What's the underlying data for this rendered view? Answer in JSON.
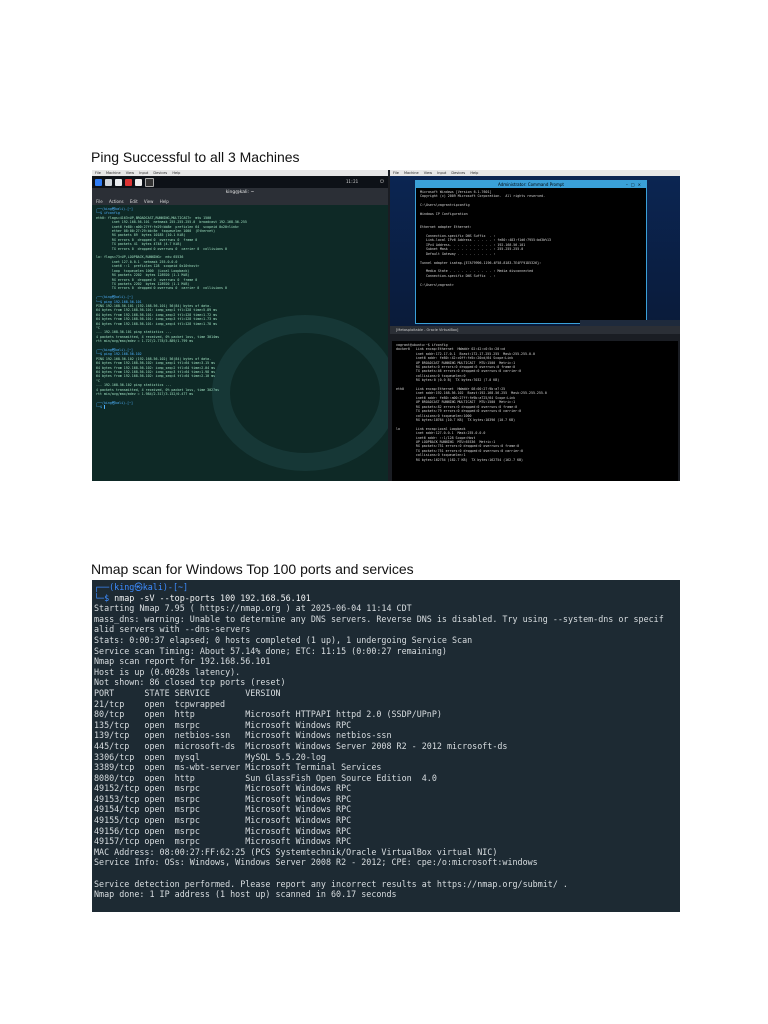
{
  "headings": {
    "ping": "Ping Successful to all 3 Machines",
    "nmap": "Nmap scan for Windows Top 100 ports and services"
  },
  "screenshot1": {
    "vm_menu": [
      "File",
      "Machine",
      "View",
      "Input",
      "Devices",
      "Help"
    ],
    "kali": {
      "window_title": "king@kali: ~",
      "term_menu": [
        "File",
        "Actions",
        "Edit",
        "View",
        "Help"
      ],
      "clock": "11:21",
      "lines": [
        "┌──(king㉿kali)-[~]",
        "└─$ ifconfig",
        "eth0: flags=4163<UP,BROADCAST,RUNNING,MULTICAST>  mtu 1500",
        "        inet 192.168.56.101  netmask 255.255.255.0  broadcast 192.168.56.255",
        "        inet6 fe80::a00:27ff:fe29:bb8e  prefixlen 64  scopeid 0x20<link>",
        "        ether 08:00:27:29:bb:8e  txqueuelen 1000  (Ethernet)",
        "        RX packets 89  bytes 10185 (10.1 KiB)",
        "        RX errors 0  dropped 0  overruns 0  frame 0",
        "        TX packets 41  bytes 4748 (4.7 KiB)",
        "        TX errors 0  dropped 0 overruns 0  carrier 0  collisions 0",
        "",
        "lo: flags=73<UP,LOOPBACK,RUNNING>  mtu 65536",
        "        inet 127.0.0.1  netmask 255.0.0.0",
        "        inet6 ::1  prefixlen 128  scopeid 0x10<host>",
        "        loop  txqueuelen 1000  (Local Loopback)",
        "        RX packets 2202  bytes 128920 (1.1 MiB)",
        "        RX errors 0  dropped 0  overruns 0  frame 0",
        "        TX packets 2202  bytes 128920 (1.1 MiB)",
        "        TX errors 0  dropped 0 overruns 0  carrier 0  collisions 0",
        "",
        "┌──(king㉿kali)-[~]",
        "└─$ ping 192.168.56.101",
        "PING 192.168.56.101 (192.168.56.101) 56(84) bytes of data.",
        "64 bytes from 192.168.56.101: icmp_seq=1 ttl=128 time=5.89 ms",
        "64 bytes from 192.168.56.101: icmp_seq=2 ttl=128 time=1.72 ms",
        "64 bytes from 192.168.56.101: icmp_seq=3 ttl=128 time=1.73 ms",
        "64 bytes from 192.168.56.101: icmp_seq=4 ttl=128 time=1.78 ms",
        "^C",
        "--- 192.168.56.101 ping statistics ---",
        "4 packets transmitted, 4 received, 0% packet loss, time 3014ms",
        "rtt min/avg/max/mdev = 1.727/2.778/5.889/1.799 ms",
        "",
        "┌──(king㉿kali)-[~]",
        "└─$ ping 192.168.56.102",
        "PING 192.168.56.102 (192.168.56.102) 56(84) bytes of data.",
        "64 bytes from 192.168.56.102: icmp_seq=1 ttl=64 time=3.15 ms",
        "64 bytes from 192.168.56.102: icmp_seq=2 ttl=64 time=2.04 ms",
        "64 bytes from 192.168.56.102: icmp_seq=3 ttl=64 time=1.98 ms",
        "64 bytes from 192.168.56.102: icmp_seq=4 ttl=64 time=2.10 ms",
        "^C",
        "--- 192.168.56.102 ping statistics ---",
        "4 packets transmitted, 4 received, 0% packet loss, time 3027ms",
        "rtt min/avg/max/mdev = 1.984/2.317/3.152/0.477 ms",
        "",
        "┌──(king㉿kali)-[~]",
        "└─$ ▌"
      ]
    },
    "windows": {
      "window_title": "Administrator: Command Prompt",
      "lines": [
        "Microsoft Windows [Version 6.1.7601]",
        "Copyright (c) 2009 Microsoft Corporation.  All rights reserved.",
        "",
        "C:\\Users\\vagrant>ipconfig",
        "",
        "Windows IP Configuration",
        "",
        "",
        "Ethernet adapter Ethernet:",
        "",
        "   Connection-specific DNS Suffix  . :",
        "   Link-local IPv6 Address . . . . . : fe80::483:f1d6:7955:bd3b%13",
        "   IPv4 Address. . . . . . . . . . . : 192.168.56.101",
        "   Subnet Mask . . . . . . . . . . . : 255.255.255.0",
        "   Default Gateway . . . . . . . . . :",
        "",
        "Tunnel adapter isatap.{E7A79996-1196-4F58-8183-7E4FF91D5326}:",
        "",
        "   Media State . . . . . . . . . . . : Media disconnected",
        "   Connection-specific DNS Suffix  . :",
        "",
        "C:\\Users\\vagrant>"
      ]
    },
    "linux": {
      "window_title": "[Metasploitable - Oracle VirtualBox]",
      "lines": [
        "vagrant@ubuntu:~$ ifconfig",
        "docker0   Link encap:Ethernet  HWaddr 02:42:c0:5c:20:cd",
        "          inet addr:172.17.0.1  Bcast:172.17.255.255  Mask:255.255.0.0",
        "          inet6 addr: fe80::42:c0ff:fe5c:20cd/64 Scope:Link",
        "          UP BROADCAST RUNNING MULTICAST  MTU:1500  Metric:1",
        "          RX packets:0 errors:0 dropped:0 overruns:0 frame:0",
        "          TX packets:46 errors:0 dropped:0 overruns:0 carrier:0",
        "          collisions:0 txqueuelen:0",
        "          RX bytes:0 (0.0 B)  TX bytes:7032 (7.0 KB)",
        "",
        "eth0      Link encap:Ethernet  HWaddr 08:00:27:9b:a7:25",
        "          inet addr:192.168.56.102  Bcast:192.168.56.255  Mask:255.255.255.0",
        "          inet6 addr: fe80::a00:27ff:fe9b:a725/64 Scope:Link",
        "          UP BROADCAST RUNNING MULTICAST  MTU:1500  Metric:1",
        "          RX packets:82 errors:0 dropped:0 overruns:0 frame:0",
        "          TX packets:79 errors:0 dropped:0 overruns:0 carrier:0",
        "          collisions:0 txqueuelen:1000",
        "          RX bytes:10764 (10.7 KB)  TX bytes:10396 (10.7 KB)",
        "",
        "lo        Link encap:Local Loopback",
        "          inet addr:127.0.0.1  Mask:255.0.0.0",
        "          inet6 addr: ::1/128 Scope:Host",
        "          UP LOOPBACK RUNNING  MTU:65536  Metric:1",
        "          RX packets:751 errors:0 dropped:0 overruns:0 frame:0",
        "          TX packets:751 errors:0 dropped:0 overruns:0 carrier:0",
        "          collisions:0 txqueuelen:1",
        "          RX bytes:162754 (162.7 KB)  TX bytes:162754 (162.7 KB)"
      ]
    }
  },
  "nmap": {
    "prompt_top": "┌──(king㉿kali)-[~]",
    "prompt_prefix": "└─$ ",
    "command": "nmap -sV --top-ports 100 192.168.56.101",
    "output_lines": [
      "Starting Nmap 7.95 ( https://nmap.org ) at 2025-06-04 11:14 CDT",
      "mass_dns: warning: Unable to determine any DNS servers. Reverse DNS is disabled. Try using --system-dns or specif",
      "alid servers with --dns-servers",
      "Stats: 0:00:37 elapsed; 0 hosts completed (1 up), 1 undergoing Service Scan",
      "Service scan Timing: About 57.14% done; ETC: 11:15 (0:00:27 remaining)",
      "Nmap scan report for 192.168.56.101",
      "Host is up (0.0028s latency).",
      "Not shown: 86 closed tcp ports (reset)",
      "PORT      STATE SERVICE       VERSION",
      "21/tcp    open  tcpwrapped",
      "80/tcp    open  http          Microsoft HTTPAPI httpd 2.0 (SSDP/UPnP)",
      "135/tcp   open  msrpc         Microsoft Windows RPC",
      "139/tcp   open  netbios-ssn   Microsoft Windows netbios-ssn",
      "445/tcp   open  microsoft-ds  Microsoft Windows Server 2008 R2 - 2012 microsoft-ds",
      "3306/tcp  open  mysql         MySQL 5.5.20-log",
      "3389/tcp  open  ms-wbt-server Microsoft Terminal Services",
      "8080/tcp  open  http          Sun GlassFish Open Source Edition  4.0",
      "49152/tcp open  msrpc         Microsoft Windows RPC",
      "49153/tcp open  msrpc         Microsoft Windows RPC",
      "49154/tcp open  msrpc         Microsoft Windows RPC",
      "49155/tcp open  msrpc         Microsoft Windows RPC",
      "49156/tcp open  msrpc         Microsoft Windows RPC",
      "49157/tcp open  msrpc         Microsoft Windows RPC",
      "MAC Address: 08:00:27:FF:62:25 (PCS Systemtechnik/Oracle VirtualBox virtual NIC)",
      "Service Info: OSs: Windows, Windows Server 2008 R2 - 2012; CPE: cpe:/o:microsoft:windows",
      "",
      "Service detection performed. Please report any incorrect results at https://nmap.org/submit/ .",
      "Nmap done: 1 IP address (1 host up) scanned in 60.17 seconds"
    ]
  },
  "colors": {
    "kali_bg": "#14322f",
    "nmap_bg": "#1d2a33",
    "prompt_blue": "#3d8cff",
    "cmd_title": "#3aa0d8"
  }
}
